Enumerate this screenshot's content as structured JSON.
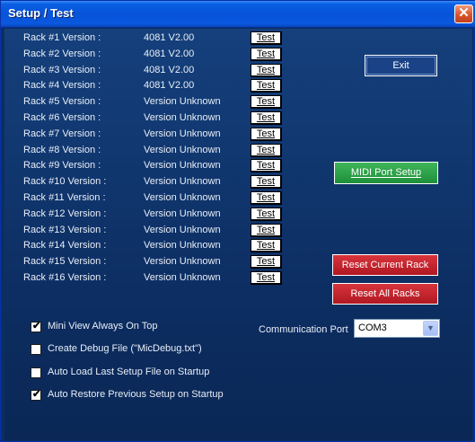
{
  "window": {
    "title": "Setup / Test",
    "close_glyph": "✕"
  },
  "racks": [
    {
      "label": "Rack #1  Version :",
      "version": "4081 V2.00"
    },
    {
      "label": "Rack #2  Version :",
      "version": "4081 V2.00"
    },
    {
      "label": "Rack #3  Version :",
      "version": "4081 V2.00"
    },
    {
      "label": "Rack #4  Version :",
      "version": "4081 V2.00"
    },
    {
      "label": "Rack #5  Version :",
      "version": "Version Unknown"
    },
    {
      "label": "Rack #6  Version :",
      "version": "Version Unknown"
    },
    {
      "label": "Rack #7  Version :",
      "version": "Version Unknown"
    },
    {
      "label": "Rack #8  Version :",
      "version": "Version Unknown"
    },
    {
      "label": "Rack #9  Version :",
      "version": "Version Unknown"
    },
    {
      "label": "Rack #10 Version :",
      "version": "Version Unknown"
    },
    {
      "label": "Rack #11 Version :",
      "version": "Version Unknown"
    },
    {
      "label": "Rack #12 Version :",
      "version": "Version Unknown"
    },
    {
      "label": "Rack #13 Version :",
      "version": "Version Unknown"
    },
    {
      "label": "Rack #14 Version :",
      "version": "Version Unknown"
    },
    {
      "label": "Rack #15 Version :",
      "version": "Version Unknown"
    },
    {
      "label": "Rack #16 Version :",
      "version": "Version Unknown"
    }
  ],
  "test_label": "Test",
  "buttons": {
    "exit": "Exit",
    "midi_port_setup": "MIDI Port Setup",
    "reset_current_rack": "Reset Current Rack",
    "reset_all_racks": "Reset All Racks"
  },
  "options": [
    {
      "label": "Mini View Always On Top",
      "checked": true
    },
    {
      "label": "Create Debug File (\"MicDebug.txt\")",
      "checked": false
    },
    {
      "label": "Auto Load Last Setup File on Startup",
      "checked": false
    },
    {
      "label": "Auto Restore Previous Setup on Startup",
      "checked": true
    }
  ],
  "communication_port": {
    "label": "Communication Port",
    "value": "COM3"
  },
  "colors": {
    "title_bar": "#0753d8",
    "background": "#0c2e62",
    "midi_button": "#1f8f3a",
    "reset_buttons": "#b01822"
  }
}
